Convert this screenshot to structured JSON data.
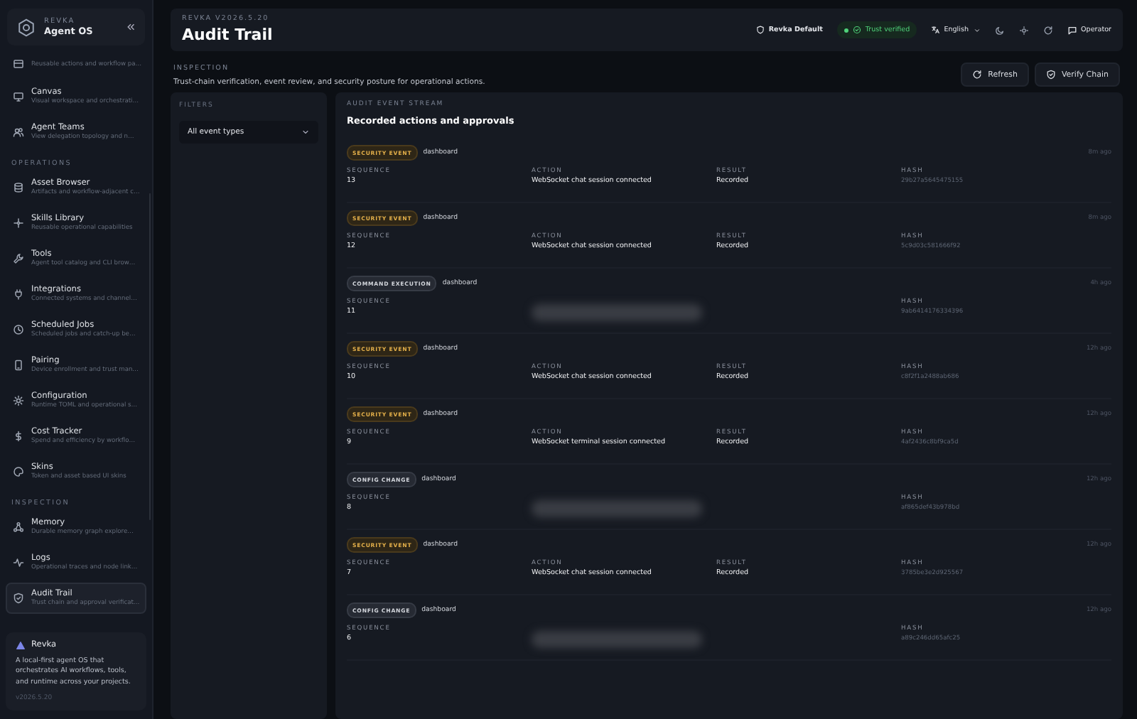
{
  "sidebar": {
    "brand": {
      "eyebrow": "REVKA",
      "title": "Agent OS"
    },
    "sections": [
      {
        "items": [
          {
            "subtitle": "Reusable actions and workflow pa…",
            "selected": false
          },
          {
            "title": "Canvas",
            "subtitle": "Visual workspace and orchestrati…",
            "selected": false
          },
          {
            "title": "Agent Teams",
            "subtitle": "View delegation topology and n…",
            "selected": false
          }
        ]
      },
      {
        "heading": "OPERATIONS",
        "items": [
          {
            "title": "Asset Browser",
            "subtitle": "Artifacts and workflow-adjacent c…",
            "selected": false
          },
          {
            "title": "Skills Library",
            "subtitle": "Reusable operational capabilities",
            "selected": false
          },
          {
            "title": "Tools",
            "subtitle": "Agent tool catalog and CLI brow…",
            "selected": false
          },
          {
            "title": "Integrations",
            "subtitle": "Connected systems and channel…",
            "selected": false
          },
          {
            "title": "Scheduled Jobs",
            "subtitle": "Scheduled jobs and catch-up be…",
            "selected": false
          },
          {
            "title": "Pairing",
            "subtitle": "Device enrollment and trust man…",
            "selected": false
          },
          {
            "title": "Configuration",
            "subtitle": "Runtime TOML and operational s…",
            "selected": false
          },
          {
            "title": "Cost Tracker",
            "subtitle": "Spend and efficiency by workflo…",
            "selected": false
          },
          {
            "title": "Skins",
            "subtitle": "Token and asset based UI skins",
            "selected": false
          }
        ]
      },
      {
        "heading": "INSPECTION",
        "items": [
          {
            "title": "Memory",
            "subtitle": "Durable memory graph explore…",
            "selected": false
          },
          {
            "title": "Logs",
            "subtitle": "Operational traces and node link…",
            "selected": false
          },
          {
            "title": "Audit Trail",
            "subtitle": "Trust chain and approval verificat…",
            "selected": true
          }
        ]
      }
    ],
    "about": {
      "title": "Revka",
      "text": "A local-first agent OS that orchestrates AI workflows, tools, and runtime across your projects.",
      "version": "v2026.5.20"
    }
  },
  "header": {
    "eyebrow": "REVKA V2026.5.20",
    "title": "Audit Trail",
    "profile": "Revka Default",
    "trust": "Trust verified",
    "language": "English",
    "user": "Operator"
  },
  "page": {
    "eyebrow": "INSPECTION",
    "description": "Trust-chain verification, event review, and security posture for operational actions.",
    "buttons": [
      {
        "label": "Refresh"
      },
      {
        "label": "Verify Chain"
      }
    ]
  },
  "filters": {
    "heading": "FILTERS",
    "select": "All event types"
  },
  "stream": {
    "eyebrow": "AUDIT EVENT STREAM",
    "title": "Recorded actions and approvals",
    "rows": [
      {
        "kind": "security",
        "tag": "SECURITY EVENT",
        "source": "dashboard",
        "time": "8m ago",
        "fields": [
          {
            "label": "SEQUENCE",
            "value": "13"
          },
          {
            "label": "ACTION",
            "value": "WebSocket chat session connected"
          },
          {
            "label": "RESULT",
            "value": "Recorded"
          },
          {
            "label": "HASH",
            "value": "29b27a5645475155"
          }
        ]
      },
      {
        "kind": "security",
        "tag": "SECURITY EVENT",
        "source": "dashboard",
        "time": "8m ago",
        "fields": [
          {
            "label": "SEQUENCE",
            "value": "12"
          },
          {
            "label": "ACTION",
            "value": "WebSocket chat session connected"
          },
          {
            "label": "RESULT",
            "value": "Recorded"
          },
          {
            "label": "HASH",
            "value": "5c9d03c581666f92"
          }
        ]
      },
      {
        "kind": "command",
        "tag": "COMMAND EXECUTION",
        "source": "dashboard",
        "time": "4h ago",
        "fields": [
          {
            "label": "SEQUENCE",
            "value": "11"
          },
          {
            "label": "HASH",
            "value": "9ab6414176334396"
          }
        ]
      },
      {
        "kind": "security",
        "tag": "SECURITY EVENT",
        "source": "dashboard",
        "time": "12h ago",
        "fields": [
          {
            "label": "SEQUENCE",
            "value": "10"
          },
          {
            "label": "ACTION",
            "value": "WebSocket chat session connected"
          },
          {
            "label": "RESULT",
            "value": "Recorded"
          },
          {
            "label": "HASH",
            "value": "c8f2f1a2488ab686"
          }
        ]
      },
      {
        "kind": "security",
        "tag": "SECURITY EVENT",
        "source": "dashboard",
        "time": "12h ago",
        "fields": [
          {
            "label": "SEQUENCE",
            "value": "9"
          },
          {
            "label": "ACTION",
            "value": "WebSocket terminal session connected"
          },
          {
            "label": "RESULT",
            "value": "Recorded"
          },
          {
            "label": "HASH",
            "value": "4af2436c8bf9ca5d"
          }
        ]
      },
      {
        "kind": "config",
        "tag": "CONFIG CHANGE",
        "source": "dashboard",
        "time": "12h ago",
        "fields": [
          {
            "label": "SEQUENCE",
            "value": "8"
          },
          {
            "label": "HASH",
            "value": "af865def43b978bd"
          }
        ]
      },
      {
        "kind": "security",
        "tag": "SECURITY EVENT",
        "source": "dashboard",
        "time": "12h ago",
        "fields": [
          {
            "label": "SEQUENCE",
            "value": "7"
          },
          {
            "label": "ACTION",
            "value": "WebSocket chat session connected"
          },
          {
            "label": "RESULT",
            "value": "Recorded"
          },
          {
            "label": "HASH",
            "value": "3785be3e2d925567"
          }
        ]
      },
      {
        "kind": "config",
        "tag": "CONFIG CHANGE",
        "source": "dashboard",
        "time": "12h ago",
        "fields": [
          {
            "label": "SEQUENCE",
            "value": "6"
          },
          {
            "label": "HASH",
            "value": "a89c246dd65afc25"
          }
        ]
      }
    ]
  }
}
